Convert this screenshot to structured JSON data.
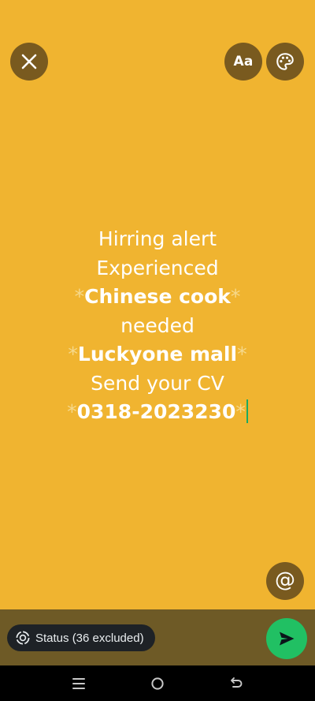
{
  "toolbar": {
    "close_icon": "close-icon",
    "font_label": "Aa",
    "palette_icon": "palette-icon"
  },
  "status_text": {
    "line1": "Hirring alert",
    "line2": "Experienced",
    "line3_star_open": "*",
    "line3_bold": "Chinese cook",
    "line3_star_close": "*",
    "line4": "needed",
    "line5_star_open": "*",
    "line5_bold": "Luckyone mall",
    "line5_star_close": "*",
    "line6": "Send your CV",
    "line7_star_open": "*",
    "line7_bold": "0318-2023230",
    "line7_star_close": "*"
  },
  "mention": {
    "label": "@"
  },
  "bottom": {
    "audience_label": "Status (36 excluded)",
    "send_icon": "send-icon"
  },
  "nav": {
    "recents_icon": "recents-icon",
    "home_icon": "home-icon",
    "back_icon": "back-icon"
  },
  "colors": {
    "background": "#F0B430",
    "bottom_bar": "#6E5A26",
    "send_button": "#21C063",
    "cursor": "#1DAA61"
  }
}
